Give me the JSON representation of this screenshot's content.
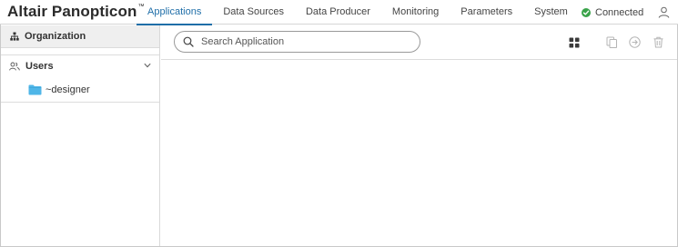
{
  "app": {
    "brand": "Altair Panopticon",
    "trademark": "™"
  },
  "nav": {
    "tabs": [
      {
        "label": "Applications",
        "active": true
      },
      {
        "label": "Data Sources",
        "active": false
      },
      {
        "label": "Data Producer",
        "active": false
      },
      {
        "label": "Monitoring",
        "active": false
      },
      {
        "label": "Parameters",
        "active": false
      },
      {
        "label": "System",
        "active": false
      }
    ]
  },
  "status": {
    "label": "Connected",
    "color": "#3aa34a"
  },
  "sidebar": {
    "organization_label": "Organization",
    "users_label": "Users",
    "folder_label": "~designer",
    "folder_color": "#4fb6e8"
  },
  "search": {
    "placeholder": "Search Application",
    "value": ""
  },
  "colors": {
    "accent": "#1f6ea8",
    "icon_muted": "#b5b5b5",
    "icon_dark": "#3a3a3a"
  }
}
